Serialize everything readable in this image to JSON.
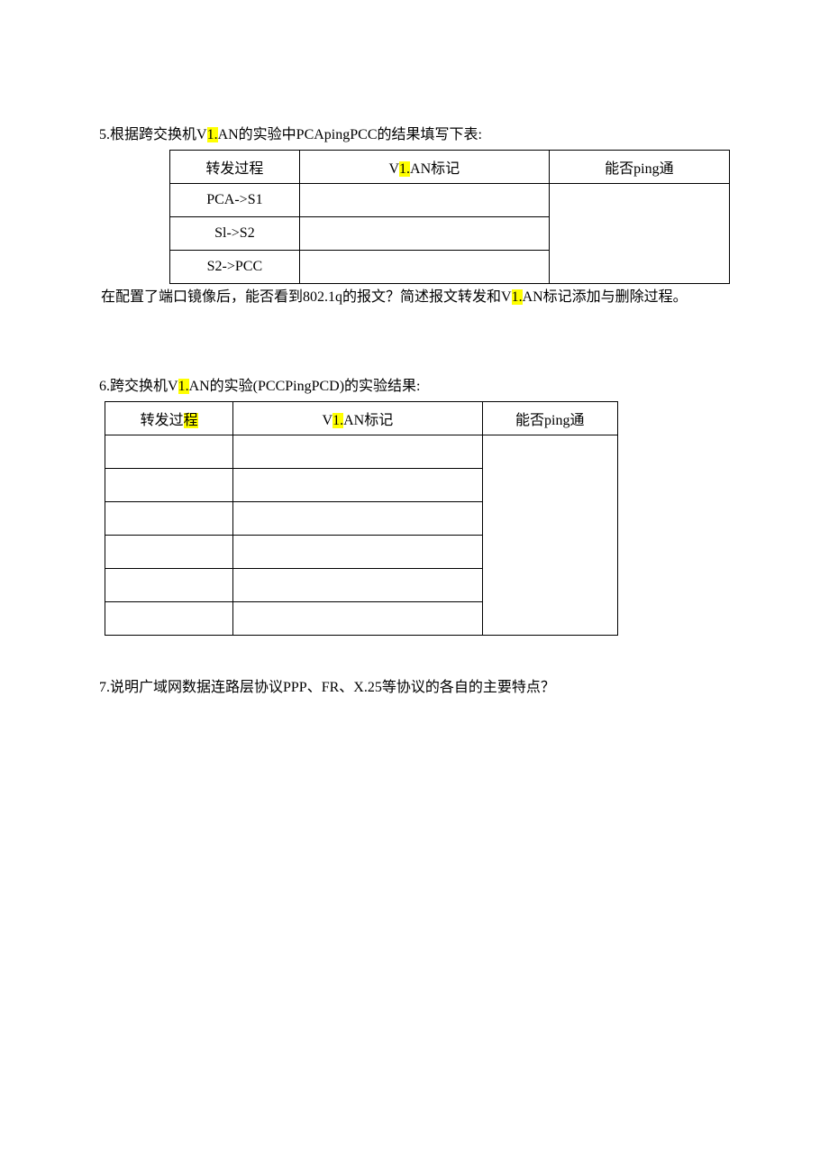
{
  "q5": {
    "prefix": "5.根据跨交换机V",
    "hl": "1.",
    "suffix": "AN的实验中PCApingPCC的结果填写下表:",
    "headers": {
      "col1": "转发过程",
      "col2_prefix": "V",
      "col2_hl": "1.",
      "col2_suffix": "AN标记",
      "col3": "能否ping通"
    },
    "rows": [
      {
        "process": "PCA->S1",
        "mark": "",
        "ping": ""
      },
      {
        "process": "Sl->S2",
        "mark": "",
        "ping": ""
      },
      {
        "process": "S2->PCC",
        "mark": "",
        "ping": ""
      }
    ],
    "note_prefix": "在配置了端口镜像后，能否看到802.1q的报文？简述报文转发和V",
    "note_hl": "1.",
    "note_suffix": "AN标记添加与删除过程。"
  },
  "q6": {
    "prefix": "6.跨交换机V",
    "hl": "1.",
    "suffix": "AN的实验(PCCPingPCD)的实验结果:",
    "headers": {
      "col1_prefix": "转发过",
      "col1_hl": "程",
      "col2_prefix": "V",
      "col2_hl": "1.",
      "col2_suffix": "AN标记",
      "col3": "能否ping通"
    },
    "rows": [
      {
        "process": "",
        "mark": "",
        "ping": ""
      },
      {
        "process": "",
        "mark": "",
        "ping": ""
      },
      {
        "process": "",
        "mark": "",
        "ping": ""
      },
      {
        "process": "",
        "mark": "",
        "ping": ""
      },
      {
        "process": "",
        "mark": "",
        "ping": ""
      },
      {
        "process": "",
        "mark": "",
        "ping": ""
      }
    ]
  },
  "q7": {
    "text": "7.说明广域网数据连路层协议PPP、FR、X.25等协议的各自的主要特点？"
  }
}
